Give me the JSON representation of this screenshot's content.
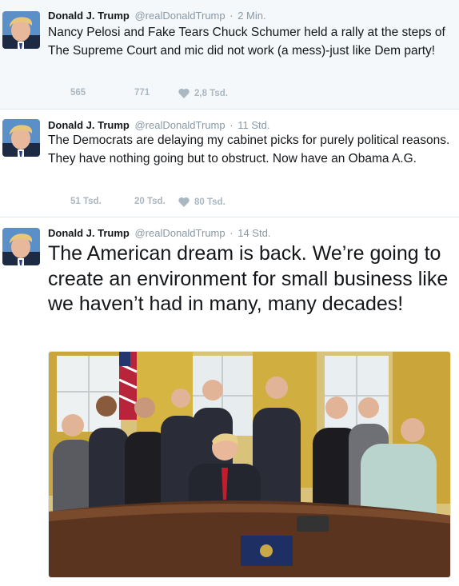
{
  "tweets": [
    {
      "name": "Donald J. Trump",
      "handle": "@realDonaldTrump",
      "separator": "·",
      "time": "2 Min.",
      "text": "Nancy Pelosi and Fake Tears Chuck Schumer held a rally  at the steps of The Supreme Court and mic did not work (a mess)-just like Dem party!",
      "retweets": "565",
      "likes_retweet_alt": "771",
      "likes": "2,8 Tsd."
    },
    {
      "name": "Donald J. Trump",
      "handle": "@realDonaldTrump",
      "separator": "·",
      "time": "11 Std.",
      "text": "The Democrats are delaying my cabinet picks for purely political reasons. They have nothing going but to obstruct. Now have an Obama A.G.",
      "retweets": "51 Tsd.",
      "likes_retweet_alt": "20 Tsd.",
      "likes": "80 Tsd."
    },
    {
      "name": "Donald J. Trump",
      "handle": "@realDonaldTrump",
      "separator": "·",
      "time": "14 Std.",
      "text": "The American dream is back. We’re going to create an environment for small business like we haven’t had in many, many decades!"
    }
  ],
  "colors": {
    "name": "#14171a",
    "meta": "#8899a6",
    "action": "#aab8c2",
    "highlight_bg": "#f5f8fa",
    "divider": "#e1e8ed"
  },
  "icons": {
    "like": "heart-icon"
  }
}
